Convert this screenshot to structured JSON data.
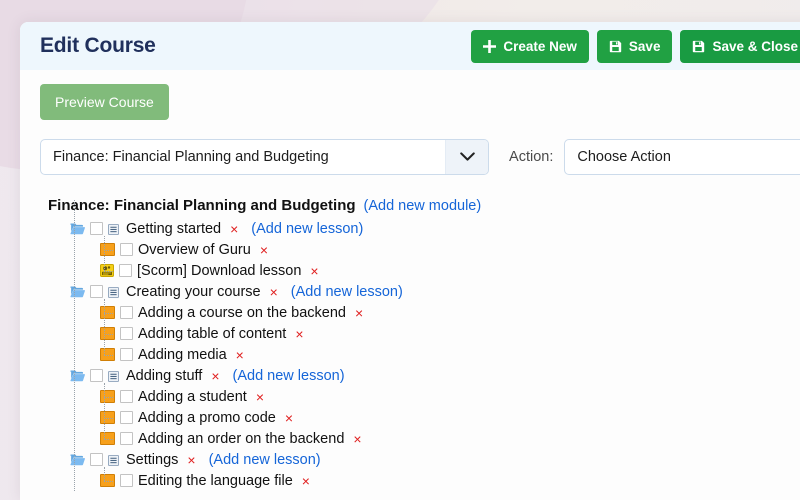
{
  "header": {
    "title": "Edit Course",
    "buttons": [
      {
        "label": "Create New",
        "icon": "plus-icon",
        "color": "#21a143"
      },
      {
        "label": "Save",
        "icon": "save-disk-icon",
        "color": "#21a143"
      },
      {
        "label": "Save & Close",
        "icon": "save-disk-icon",
        "color": "#199b42"
      }
    ]
  },
  "toolbar": {
    "preview_label": "Preview Course",
    "preview_color": "#81bb7b"
  },
  "selector": {
    "course_value": "Finance: Financial Planning and Budgeting",
    "course_arrow_icon": "chevron-down-icon",
    "action_label": "Action:",
    "action_value": "Choose Action"
  },
  "tree": {
    "root_title": "Finance: Financial Planning and Budgeting",
    "add_module_label": "(Add new module)",
    "add_lesson_label": "(Add new lesson)",
    "delete_mark": "×",
    "link_color": "#1565d8",
    "delete_color": "#e02020",
    "modules": [
      {
        "title": "Getting started",
        "icon": "folder-open-icon",
        "toggle": "collapse-toggle-icon",
        "lessons": [
          {
            "title": "Overview of Guru",
            "icon": "lesson-orange-icon"
          },
          {
            "title": "[Scorm] Download lesson",
            "icon": "scorm-yellow-icon"
          }
        ]
      },
      {
        "title": "Creating your course",
        "icon": "folder-open-icon",
        "toggle": "collapse-toggle-icon",
        "lessons": [
          {
            "title": "Adding a course on the backend",
            "icon": "lesson-orange-icon"
          },
          {
            "title": "Adding table of content",
            "icon": "lesson-orange-icon"
          },
          {
            "title": "Adding media",
            "icon": "lesson-orange-icon"
          }
        ]
      },
      {
        "title": "Adding stuff",
        "icon": "folder-open-icon",
        "toggle": "collapse-toggle-icon",
        "lessons": [
          {
            "title": "Adding a student",
            "icon": "lesson-orange-icon"
          },
          {
            "title": "Adding a promo code",
            "icon": "lesson-orange-icon"
          },
          {
            "title": "Adding an order on the backend",
            "icon": "lesson-orange-icon"
          }
        ]
      },
      {
        "title": "Settings",
        "icon": "folder-open-icon",
        "toggle": "collapse-toggle-icon",
        "lessons": [
          {
            "title": "Editing the language file",
            "icon": "lesson-orange-icon"
          }
        ]
      }
    ]
  }
}
